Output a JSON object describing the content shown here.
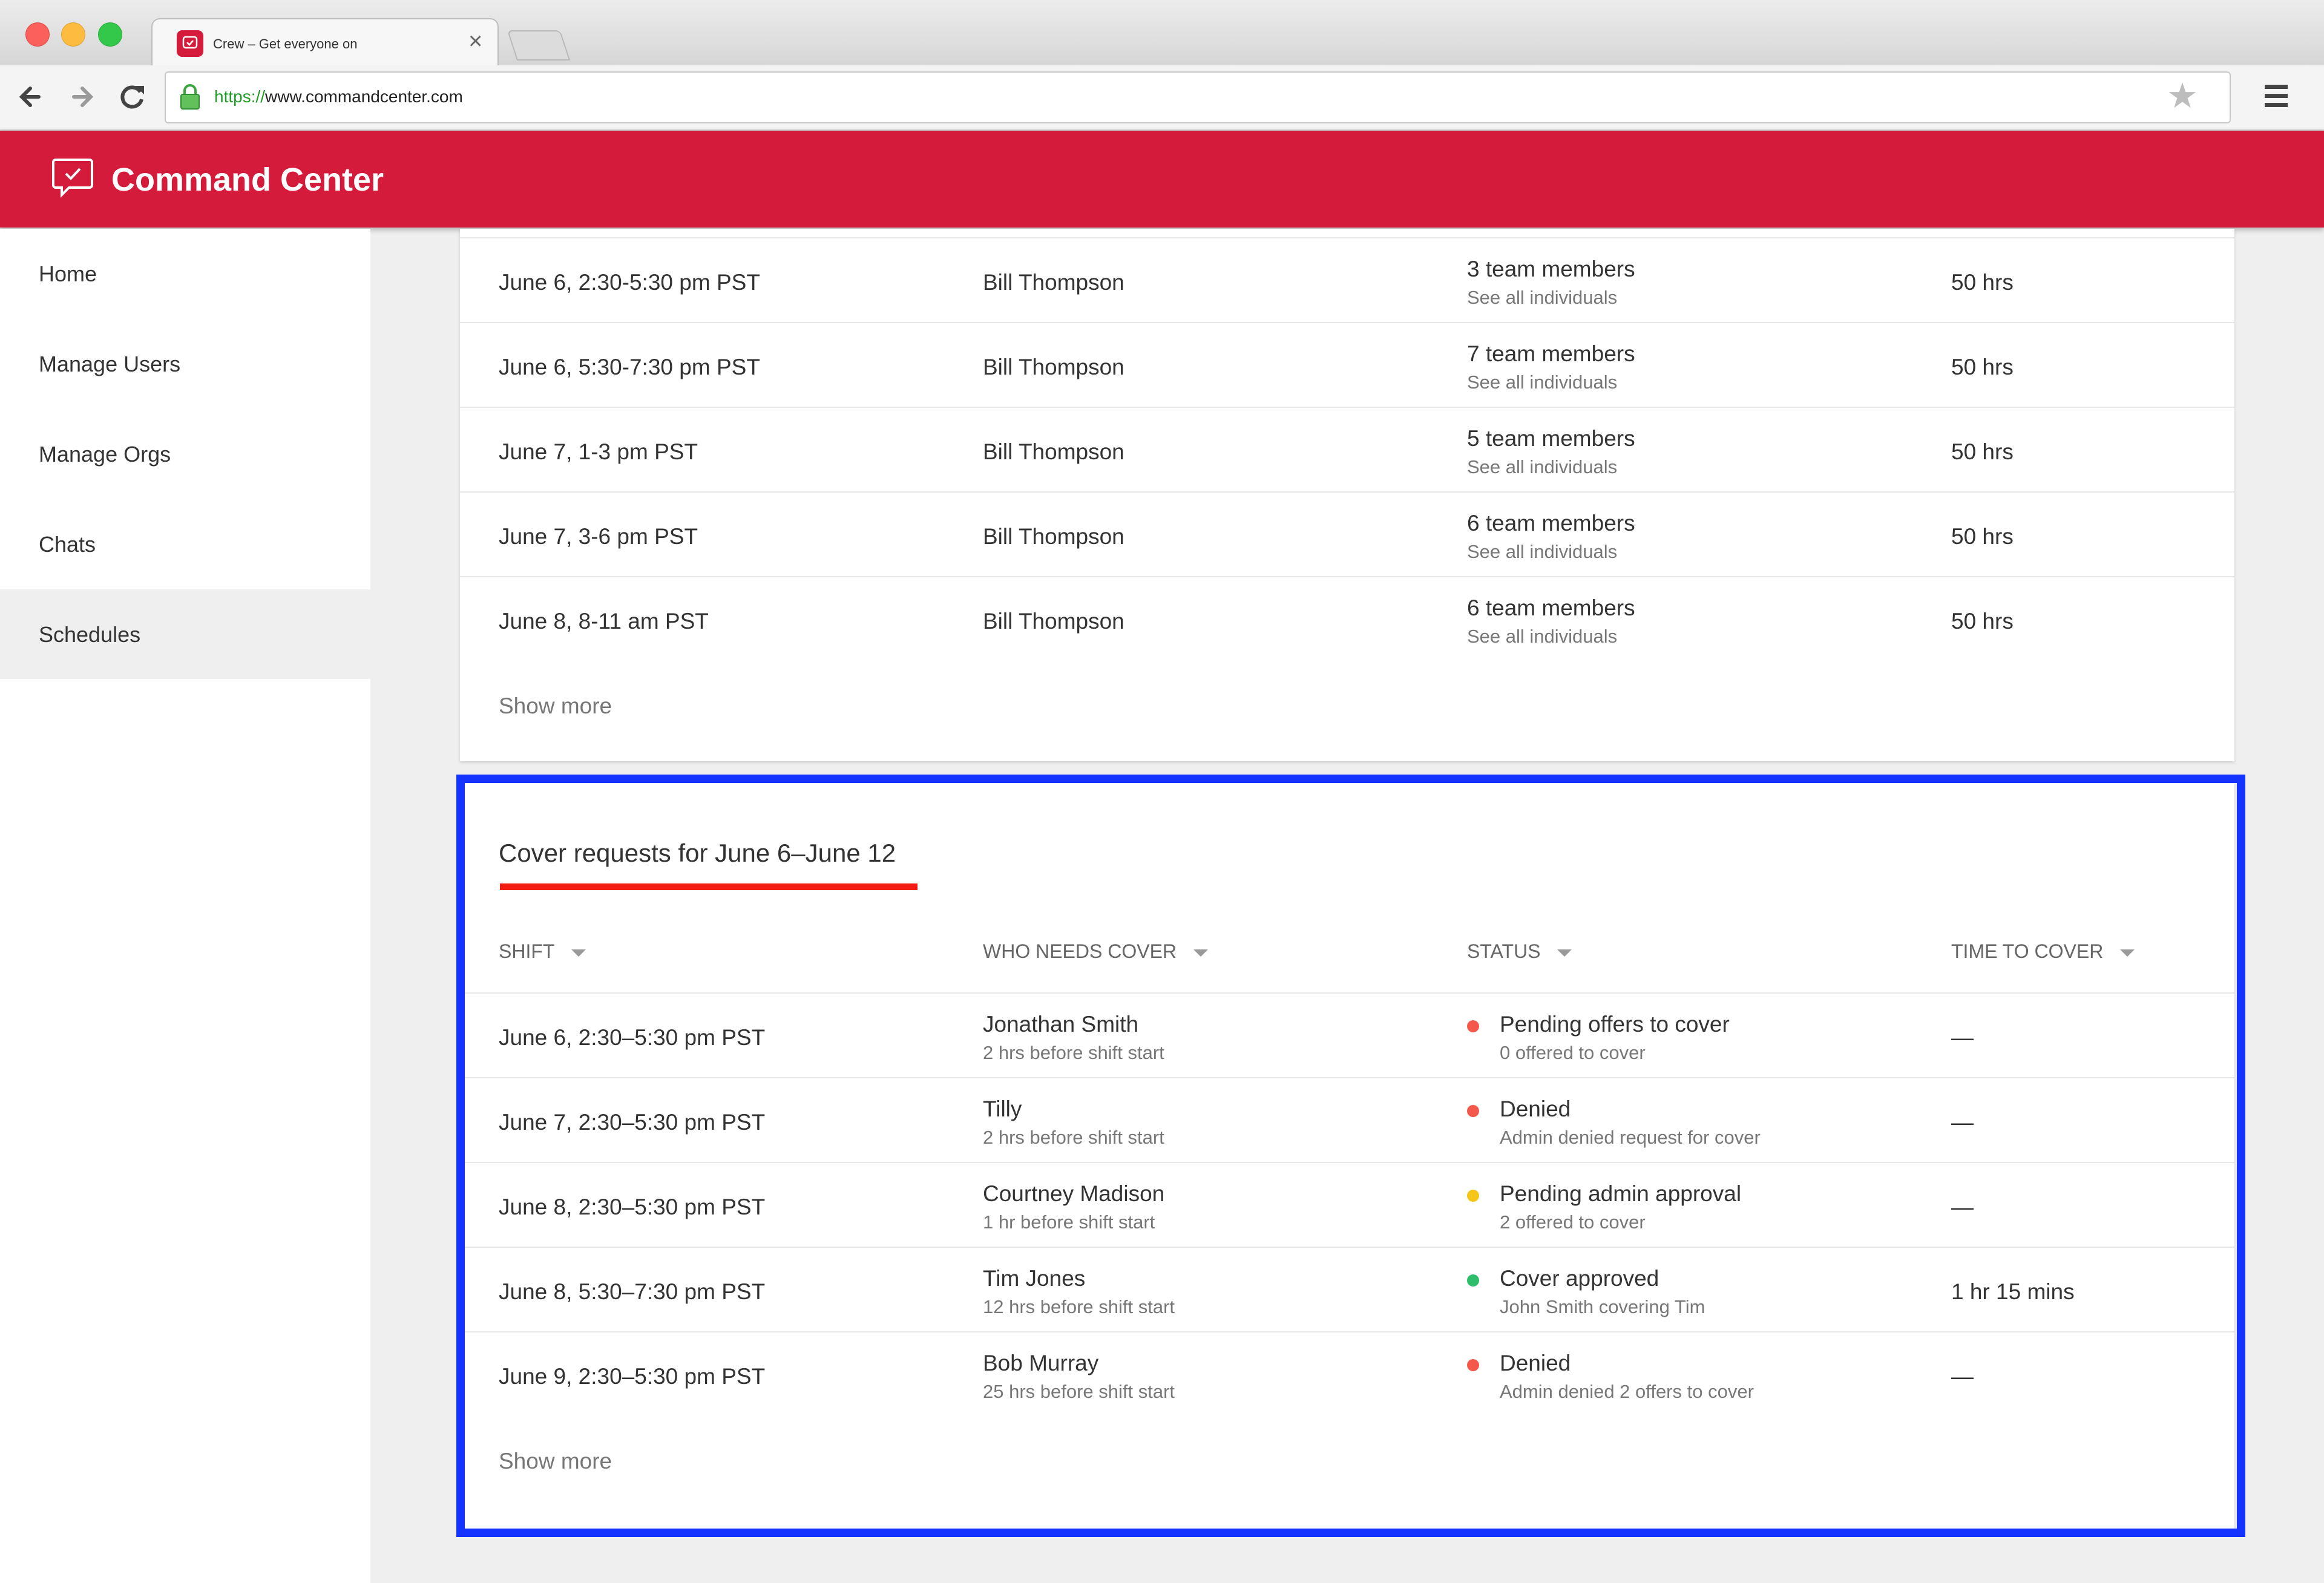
{
  "browser": {
    "tab_title": "Crew – Get everyone on",
    "url_protocol": "https://",
    "url_host": "www.commandcenter.com"
  },
  "app": {
    "title": "Command Center",
    "brand_color": "#d41b3b"
  },
  "sidebar": {
    "items": [
      {
        "label": "Home"
      },
      {
        "label": "Manage Users"
      },
      {
        "label": "Manage Orgs"
      },
      {
        "label": "Chats"
      },
      {
        "label": "Schedules",
        "active": true
      }
    ]
  },
  "schedule_table": {
    "rows": [
      {
        "shift": "June 6, 2:30-5:30 pm PST",
        "owner": "Bill Thompson",
        "members": "3 team members",
        "members_link": "See all individuals",
        "hours": "50 hrs"
      },
      {
        "shift": "June 6, 5:30-7:30 pm PST",
        "owner": "Bill Thompson",
        "members": "7 team members",
        "members_link": "See all individuals",
        "hours": "50 hrs"
      },
      {
        "shift": "June 7, 1-3 pm PST",
        "owner": "Bill Thompson",
        "members": "5 team members",
        "members_link": "See all individuals",
        "hours": "50 hrs"
      },
      {
        "shift": "June 7, 3-6 pm PST",
        "owner": "Bill Thompson",
        "members": "6 team members",
        "members_link": "See all individuals",
        "hours": "50 hrs"
      },
      {
        "shift": "June 8, 8-11 am PST",
        "owner": "Bill Thompson",
        "members": "6 team members",
        "members_link": "See all individuals",
        "hours": "50 hrs"
      }
    ],
    "show_more": "Show more"
  },
  "cover_requests": {
    "title": "Cover requests for June 6–June 12",
    "columns": [
      "SHIFT",
      "WHO NEEDS COVER",
      "STATUS",
      "TIME TO COVER"
    ],
    "rows": [
      {
        "shift": "June 6, 2:30–5:30 pm PST",
        "who": "Jonathan Smith",
        "who_sub": "2 hrs before shift start",
        "status": "Pending offers to cover",
        "status_sub": "0 offered to cover",
        "status_color": "#f4574b",
        "time": "—"
      },
      {
        "shift": "June 7, 2:30–5:30 pm PST",
        "who": "Tilly",
        "who_sub": "2 hrs before shift start",
        "status": "Denied",
        "status_sub": "Admin denied request for cover",
        "status_color": "#f4574b",
        "time": "—"
      },
      {
        "shift": "June 8, 2:30–5:30 pm PST",
        "who": "Courtney Madison",
        "who_sub": "1 hr before shift start",
        "status": "Pending admin approval",
        "status_sub": "2 offered to cover",
        "status_color": "#f5c518",
        "time": "—"
      },
      {
        "shift": "June 8, 5:30–7:30 pm PST",
        "who": "Tim Jones",
        "who_sub": "12 hrs before shift start",
        "status": "Cover approved",
        "status_sub": "John Smith covering Tim",
        "status_color": "#2ebd6b",
        "time": "1 hr 15 mins"
      },
      {
        "shift": "June 9, 2:30–5:30 pm PST",
        "who": "Bob Murray",
        "who_sub": "25 hrs before shift start",
        "status": "Denied",
        "status_sub": "Admin denied 2 offers to cover",
        "status_color": "#f4574b",
        "time": "—"
      }
    ],
    "show_more": "Show more"
  }
}
